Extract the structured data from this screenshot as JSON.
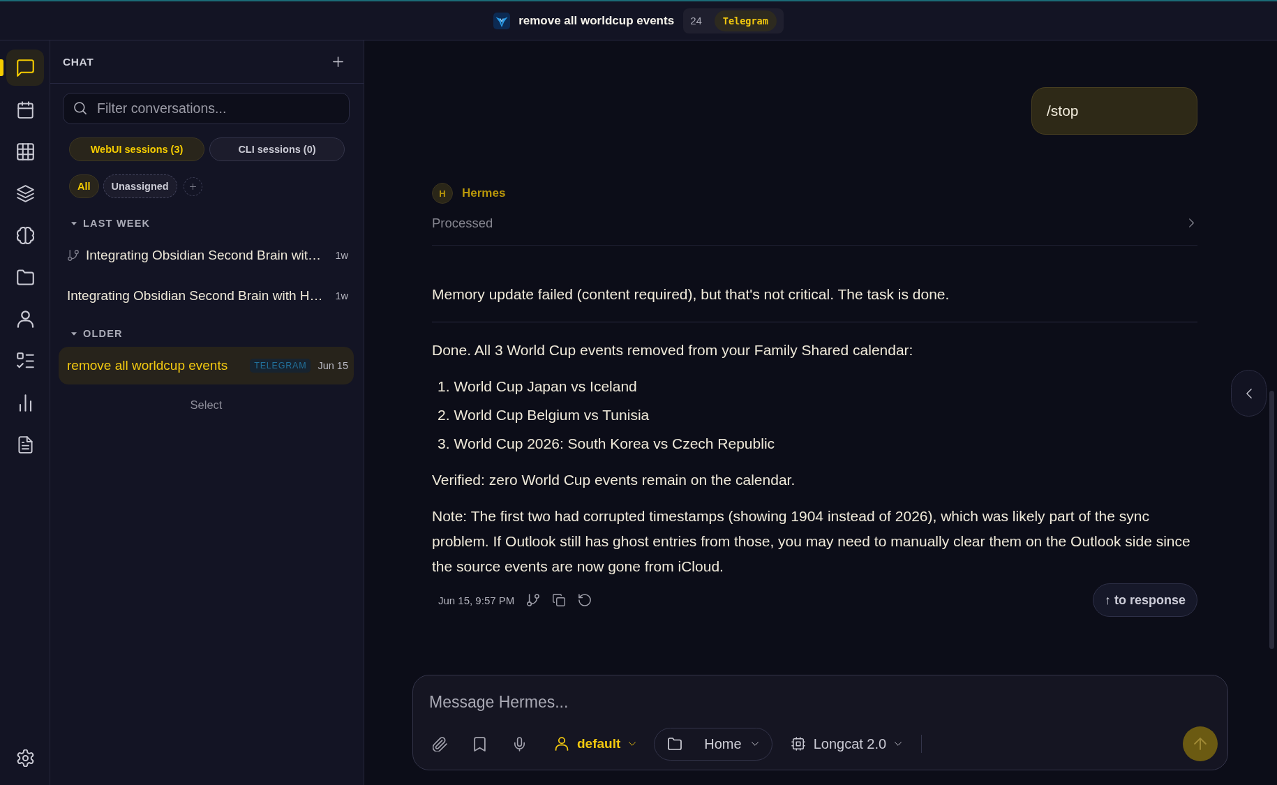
{
  "top_bar": {
    "title": "remove all worldcup events",
    "count": "24",
    "source": "Telegram"
  },
  "rail": {
    "items": [
      {
        "kind": "chat",
        "selected": true
      },
      {
        "kind": "calendar",
        "selected": false
      },
      {
        "kind": "table",
        "selected": false
      },
      {
        "kind": "layers",
        "selected": false
      },
      {
        "kind": "memory",
        "selected": false
      },
      {
        "kind": "files",
        "selected": false
      },
      {
        "kind": "profiles",
        "selected": false
      },
      {
        "kind": "tasks",
        "selected": false
      },
      {
        "kind": "analytics",
        "selected": false
      },
      {
        "kind": "documents",
        "selected": false
      }
    ],
    "bottom_items": [
      {
        "kind": "settings",
        "selected": false
      }
    ]
  },
  "sidebar": {
    "title": "CHAT",
    "search": {
      "placeholder": "Filter conversations..."
    },
    "tabs": [
      {
        "label": "WebUI sessions (3)",
        "selected": true
      },
      {
        "label": "CLI sessions (0)",
        "selected": false
      }
    ],
    "filters": [
      {
        "label": "All",
        "selected": true
      },
      {
        "label": "Unassigned",
        "selected": false
      }
    ],
    "groups": [
      {
        "label": "LAST WEEK",
        "expanded": true,
        "items": [
          {
            "title": "Integrating Obsidian Second Brain wit…",
            "time": "1w",
            "branched": true,
            "selected": false
          },
          {
            "title": "Integrating Obsidian Second Brain with H…",
            "time": "1w",
            "branched": false,
            "selected": false
          }
        ]
      },
      {
        "label": "OLDER",
        "expanded": true,
        "items": [
          {
            "title": "remove all worldcup events",
            "source": "TELEGRAM",
            "time": "Jun 15",
            "branched": false,
            "selected": true
          }
        ]
      }
    ],
    "select_label": "Select"
  },
  "thread": {
    "messages": [
      {
        "kind": "outgoing",
        "text": "/stop"
      },
      {
        "kind": "reply",
        "avatar": "H",
        "author": "Hermes",
        "status": {
          "label": "Processed",
          "expanded": false
        },
        "blocks": [
          {
            "kind": "paragraph",
            "text": "Memory update failed (content required), but that's not critical. The task is done."
          },
          {
            "kind": "rule"
          },
          {
            "kind": "paragraph",
            "text": "Done. All 3 World Cup events removed from your Family Shared calendar:"
          },
          {
            "kind": "list",
            "items": [
              {
                "marker": "1.",
                "text": "World Cup Japan vs Iceland"
              },
              {
                "marker": "2.",
                "text": "World Cup Belgium vs Tunisia"
              },
              {
                "marker": "3.",
                "text": "World Cup 2026: South Korea vs Czech Republic"
              }
            ]
          },
          {
            "kind": "paragraph",
            "text": "Verified: zero World Cup events remain on the calendar."
          },
          {
            "kind": "paragraph",
            "text": "Note: The first two had corrupted timestamps (showing 1904 instead of 2026), which was likely part of the sync problem. If Outlook still has ghost entries from those, you may need to manually clear them on the Outlook side since the source events are now gone from iCloud."
          }
        ],
        "time": "Jun 15, 9:57 PM",
        "jump_label": "↑ to response"
      }
    ]
  },
  "composer": {
    "placeholder": "Message Hermes...",
    "profile": "default",
    "workspace": "Home",
    "model": "Longcat 2.0"
  }
}
